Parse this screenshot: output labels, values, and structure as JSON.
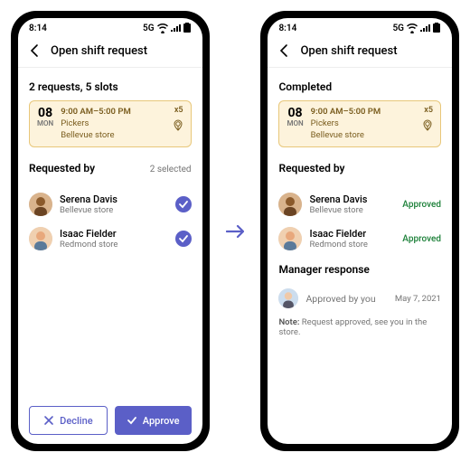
{
  "status": {
    "time": "8:14",
    "net": "5G"
  },
  "header": {
    "title": "Open shift request"
  },
  "left": {
    "summary": "2 requests, 5 slots",
    "shift": {
      "day": "08",
      "dow": "MON",
      "time": "9:00 AM–5:00 PM",
      "role": "Pickers",
      "store": "Bellevue store",
      "mult": "x5"
    },
    "req_label": "Requested by",
    "selected_label": "2 selected",
    "people": [
      {
        "name": "Serena Davis",
        "loc": "Bellevue store"
      },
      {
        "name": "Isaac Fielder",
        "loc": "Redmond store"
      }
    ],
    "decline": "Decline",
    "approve": "Approve"
  },
  "right": {
    "summary": "Completed",
    "shift": {
      "day": "08",
      "dow": "MON",
      "time": "9:00 AM–5:00 PM",
      "role": "Pickers",
      "store": "Bellevue store",
      "mult": "x5"
    },
    "req_label": "Requested by",
    "approved": "Approved",
    "people": [
      {
        "name": "Serena Davis",
        "loc": "Bellevue store"
      },
      {
        "name": "Isaac Fielder",
        "loc": "Redmond store"
      }
    ],
    "mgr_label": "Manager response",
    "mgr_text": "Approved by you",
    "mgr_date": "May 7, 2021",
    "note_prefix": "Note:",
    "note_text": " Request approved, see you in the store."
  }
}
